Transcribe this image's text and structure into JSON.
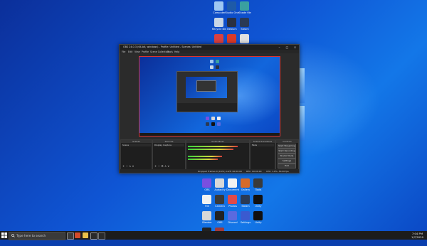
{
  "desktop": {
    "icons_top": [
      {
        "label": "Computer",
        "icon": "computer-icon",
        "color": "#9ec7f2"
      },
      {
        "label": "Studio One",
        "icon": "studio-icon",
        "color": "#1e5aa8"
      },
      {
        "label": "Shade file",
        "icon": "app-icon",
        "color": "#3aa0a0"
      },
      {
        "label": "Recycle Bin",
        "icon": "recycle-bin-icon",
        "color": "#c8d6e6"
      },
      {
        "label": "Beblum",
        "icon": "app-icon",
        "color": "#2a3040"
      },
      {
        "label": "Steam",
        "icon": "app-icon",
        "color": "#2a3a55"
      },
      {
        "label": "Programs",
        "icon": "app-icon",
        "color": "#d94040"
      },
      {
        "label": "Acrobat",
        "icon": "pdf-icon",
        "color": "#d93a2a"
      },
      {
        "label": "Capture",
        "icon": "app-icon",
        "color": "#e0e0e0"
      }
    ],
    "icons_bottom": [
      {
        "label": "OBS",
        "icon": "obs-icon",
        "color": "#7a4fe0"
      },
      {
        "label": "Audacity",
        "icon": "app-icon",
        "color": "#d8d8d8"
      },
      {
        "label": "Document",
        "icon": "document-icon",
        "color": "#f2f2f2"
      },
      {
        "label": "Gallery",
        "icon": "app-icon",
        "color": "#d66b2a"
      },
      {
        "label": "Tools",
        "icon": "app-icon",
        "color": "#3a3a3a"
      },
      {
        "label": "File",
        "icon": "document-icon",
        "color": "#f2f2f2"
      },
      {
        "label": "Camera",
        "icon": "app-icon",
        "color": "#3a3a3a"
      },
      {
        "label": "Photos",
        "icon": "app-icon",
        "color": "#e04a4a"
      },
      {
        "label": "Steam",
        "icon": "steam-icon",
        "color": "#2a3a55"
      },
      {
        "label": "Unity",
        "icon": "unity-icon",
        "color": "#111111"
      },
      {
        "label": "Blender",
        "icon": "app-icon",
        "color": "#d8d8d8"
      },
      {
        "label": "OBS",
        "icon": "obs-icon",
        "color": "#222222"
      },
      {
        "label": "Discord",
        "icon": "app-icon",
        "color": "#5a6adf"
      },
      {
        "label": "Settings",
        "icon": "gear-icon",
        "color": "#3a5ad0"
      },
      {
        "label": "Unity",
        "icon": "unity-icon",
        "color": "#111111"
      },
      {
        "label": "Code",
        "icon": "app-icon",
        "color": "#222222"
      },
      {
        "label": "Game",
        "icon": "app-icon",
        "color": "#a03a3a"
      }
    ]
  },
  "obs": {
    "title": "OBS 24.0.3 (64-bit, windows) - Profile: Untitled - Scenes: Untitled",
    "menu": [
      "File",
      "Edit",
      "View",
      "Profile",
      "Scene Collection",
      "Tools",
      "Help"
    ],
    "docks": {
      "scenes": {
        "title": "Scenes",
        "item": "Scene"
      },
      "sources": {
        "title": "Sources",
        "item": "Display Capture"
      },
      "mixer": {
        "title": "Audio Mixer"
      },
      "transitions": {
        "title": "Scene Transitions",
        "value": "Fade"
      },
      "controls": {
        "title": "Controls",
        "buttons": [
          "Start Streaming",
          "Start Recording",
          "Studio Mode",
          "Settings",
          "Exit"
        ]
      }
    },
    "status": {
      "dropped": "Dropped Frames 0 (0.0%)",
      "live": "LIVE: 00:00:00",
      "rec": "REC: 00:00:00",
      "cpu": "CPU: 1.0%, 30.00 fps"
    }
  },
  "taskbar": {
    "search_placeholder": "Type here to search",
    "time": "7:04 PM",
    "date": "1/7/2020"
  },
  "colors": {
    "accent": "#0f55d4",
    "obs_dark": "#2b2b2b",
    "preview_border": "#dd3333"
  }
}
